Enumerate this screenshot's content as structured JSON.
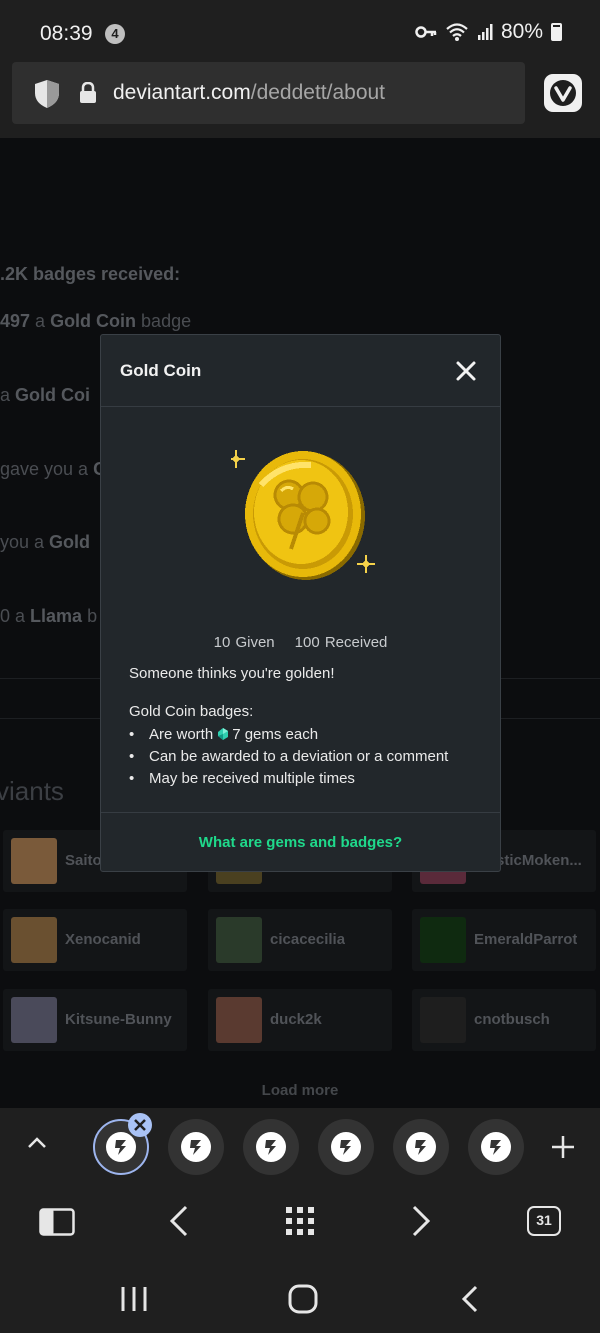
{
  "status_bar": {
    "time": "08:39",
    "notification_count": "4",
    "battery": "80%"
  },
  "url_bar": {
    "host": "deviantart.com",
    "path": "/deddett/about"
  },
  "background_page": {
    "badges_received": ".2K badges received:",
    "line1_prefix": "497",
    "line1_mid": " a ",
    "line1_bold": "Gold Coin",
    "line1_suffix": " badge",
    "line2_prefix": "a ",
    "line2_bold": "Gold Coi",
    "line3_text": "gave you a ",
    "line3_bold": "G",
    "line4_text": " you a ",
    "line4_bold": "Gold",
    "line5_prefix": "0 a ",
    "line5_bold": "Llama",
    "line5_suffix": " b",
    "section_heading": "viants",
    "cards": [
      {
        "name": "Saito"
      },
      {
        "name": ""
      },
      {
        "name": "sticMoken..."
      },
      {
        "name": "Xenocanid"
      },
      {
        "name": "cicacecilia"
      },
      {
        "name": "EmeraldParrot"
      },
      {
        "name": "Kitsune-Bunny"
      },
      {
        "name": "duck2k"
      },
      {
        "name": "cnotbusch"
      }
    ],
    "load_more": "Load more"
  },
  "modal": {
    "title": "Gold Coin",
    "given": "10 Given",
    "received": "100 Received",
    "description": "Someone thinks you're golden!",
    "list_title": "Gold Coin badges:",
    "bullet1_pre": "Are worth",
    "bullet1_post": "7 gems each",
    "bullet2": "Can be awarded to a deviation or a comment",
    "bullet3": "May be received multiple times",
    "footer_link": "What are gems and badges?"
  },
  "tab_strip": {
    "tab_count": "31"
  },
  "colors": {
    "accent_green": "#1fd98b",
    "modal_bg": "#22272b",
    "gold": "#e6b800"
  }
}
